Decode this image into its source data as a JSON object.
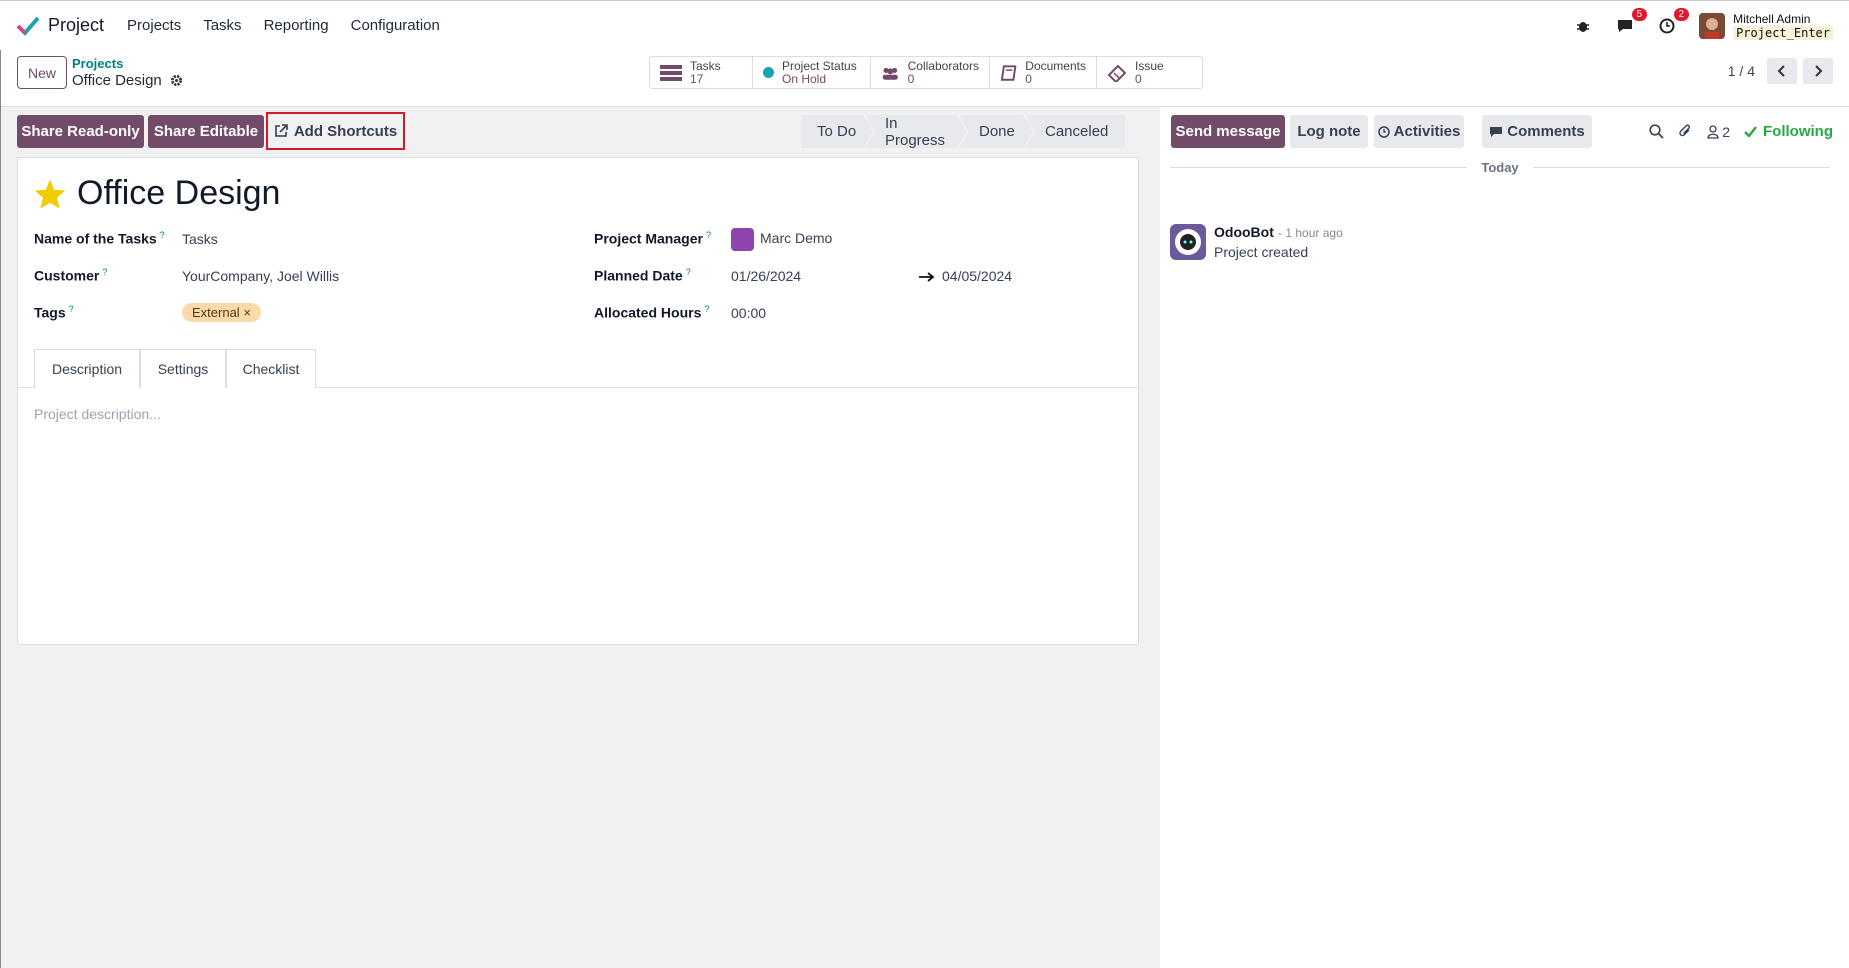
{
  "topnav": {
    "app_name": "Project",
    "menu": [
      "Projects",
      "Tasks",
      "Reporting",
      "Configuration"
    ],
    "messages_badge": "5",
    "activities_badge": "2",
    "user_name": "Mitchell Admin",
    "database": "Project_Enter"
  },
  "control_panel": {
    "new_label": "New",
    "breadcrumb_parent": "Projects",
    "breadcrumb_current": "Office Design",
    "stats": [
      {
        "label": "Tasks",
        "value": "17",
        "icon": "tasks-icon"
      },
      {
        "label": "Project Status",
        "value": "On Hold",
        "icon": "status-dot-icon"
      },
      {
        "label": "Collaborators",
        "value": "0",
        "icon": "users-icon"
      },
      {
        "label": "Documents",
        "value": "0",
        "icon": "book-icon"
      },
      {
        "label": "Issue",
        "value": "0",
        "icon": "ticket-icon"
      }
    ],
    "pager": "1 / 4"
  },
  "actions": {
    "share_readonly": "Share Read-only",
    "share_editable": "Share Editable",
    "add_shortcuts": "Add Shortcuts",
    "stages": [
      "To Do",
      "In Progress",
      "Done",
      "Canceled"
    ]
  },
  "form": {
    "title": "Office Design",
    "fields": {
      "name_of_tasks_label": "Name of the Tasks",
      "name_of_tasks_value": "Tasks",
      "customer_label": "Customer",
      "customer_value": "YourCompany, Joel Willis",
      "tags_label": "Tags",
      "tag_value": "External",
      "manager_label": "Project Manager",
      "manager_value": "Marc Demo",
      "planned_label": "Planned Date",
      "planned_start": "01/26/2024",
      "planned_end": "04/05/2024",
      "hours_label": "Allocated Hours",
      "hours_value": "00:00"
    },
    "tabs": [
      "Description",
      "Settings",
      "Checklist"
    ],
    "description_placeholder": "Project description..."
  },
  "chatter": {
    "send_message": "Send message",
    "log_note": "Log note",
    "activities": "Activities",
    "comments": "Comments",
    "followers_count": "2",
    "following": "Following",
    "date_separator": "Today",
    "messages": [
      {
        "author": "OdooBot",
        "time": "- 1 hour ago",
        "body": "Project created"
      }
    ]
  },
  "colors": {
    "primary": "#714b67",
    "link": "#017e84",
    "following": "#28a745"
  }
}
